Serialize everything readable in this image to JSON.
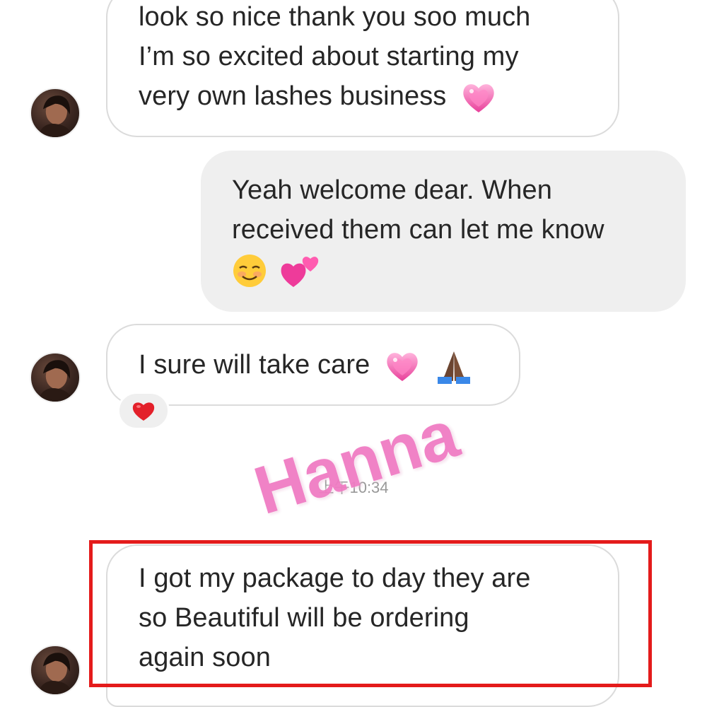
{
  "conversation": {
    "messages": [
      {
        "direction": "incoming",
        "lines": [
          "look so nice thank you soo much",
          "I’m so excited about starting my",
          "very own lashes business"
        ],
        "trailing_emoji": [
          "sparkling-heart"
        ]
      },
      {
        "direction": "outgoing",
        "lines": [
          "Yeah welcome dear. When",
          "received them can let me know"
        ],
        "trailing_emoji": [
          "smiling-face",
          "two-hearts"
        ]
      },
      {
        "direction": "incoming",
        "lines": [
          "I sure will take care"
        ],
        "trailing_emoji": [
          "sparkling-heart",
          "folded-hands-medium-dark"
        ],
        "reaction": "red-heart"
      },
      {
        "direction": "incoming",
        "lines": [
          "I got my package to day they are",
          "so Beautiful will be ordering",
          "again soon"
        ],
        "highlighted": true
      }
    ],
    "timestamp": "上午10:34"
  },
  "overlay": {
    "watermark_text": "Hanna",
    "watermark_color": "#f07cc3",
    "highlight_color": "#e41b1b"
  },
  "colors": {
    "incoming_bubble_border": "#dbdbdb",
    "outgoing_bubble_bg": "#efefef",
    "text": "#262626"
  }
}
